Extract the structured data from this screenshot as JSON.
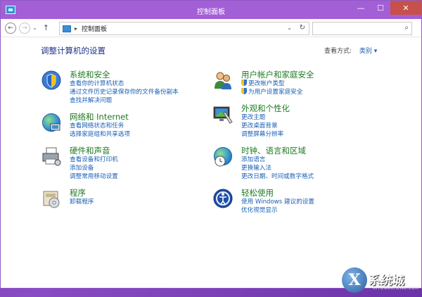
{
  "window": {
    "title": "控制面板",
    "controls": {
      "minimize": "—",
      "maximize": "☐",
      "close": "✕"
    }
  },
  "nav": {
    "back_glyph": "←",
    "forward_glyph": "→",
    "recent_glyph": "⌄",
    "up_glyph": "↑",
    "address_separator": "▸",
    "address_text": "控制面板",
    "dropdown_glyph": "⌄",
    "refresh_glyph": "↻",
    "search_placeholder": "",
    "search_glyph": "⌕"
  },
  "main": {
    "heading": "调整计算机的设置",
    "view_by_label": "查看方式:",
    "view_by_value": "类别 ▾"
  },
  "categories": [
    {
      "title": "系统和安全",
      "links": [
        "查看你的计算机状态",
        "通过文件历史记录保存你的文件备份副本",
        "查找并解决问题"
      ],
      "icon": "shield-icon"
    },
    {
      "title": "网络和 Internet",
      "links": [
        "查看网络状态和任务",
        "选择家庭组和共享选项"
      ],
      "icon": "network-icon"
    },
    {
      "title": "硬件和声音",
      "links": [
        "查看设备和打印机",
        "添加设备",
        "调整常用移动设置"
      ],
      "icon": "printer-icon"
    },
    {
      "title": "程序",
      "links": [
        "卸载程序"
      ],
      "icon": "programs-icon"
    },
    {
      "title": "用户帐户和家庭安全",
      "links": [
        "更改帐户类型",
        "为用户设置家庭安全"
      ],
      "icon": "users-icon"
    },
    {
      "title": "外观和个性化",
      "links": [
        "更改主题",
        "更改桌面背景",
        "调整屏幕分辨率"
      ],
      "icon": "appearance-icon"
    },
    {
      "title": "时钟、语言和区域",
      "links": [
        "添加语言",
        "更换输入法",
        "更改日期、时间或数字格式"
      ],
      "icon": "clock-globe-icon"
    },
    {
      "title": "轻松使用",
      "links": [
        "使用 Windows 建议的设置",
        "优化视觉显示"
      ],
      "icon": "ease-of-access-icon"
    }
  ],
  "watermark": {
    "logo": "X",
    "text": "系统城",
    "url": "XITONGCHENG.COM"
  }
}
